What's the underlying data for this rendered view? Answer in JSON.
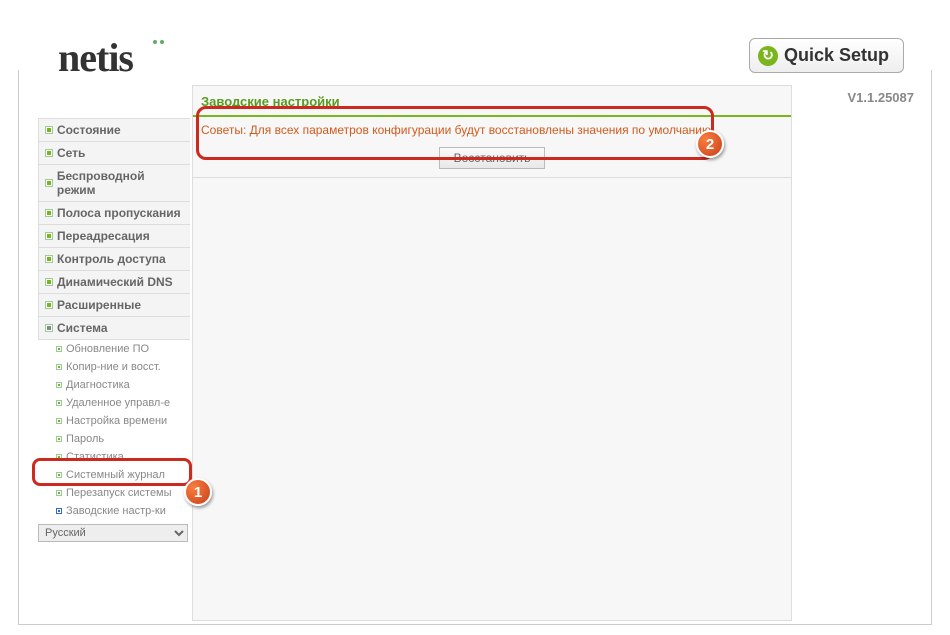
{
  "header": {
    "logo": "netis",
    "quick_setup": "Quick Setup",
    "version": "V1.1.25087"
  },
  "sidebar": {
    "items": [
      {
        "label": "Состояние"
      },
      {
        "label": "Сеть"
      },
      {
        "label": "Беспроводной режим"
      },
      {
        "label": "Полоса пропускания"
      },
      {
        "label": "Переадресация"
      },
      {
        "label": "Контроль доступа"
      },
      {
        "label": "Динамический DNS"
      },
      {
        "label": "Расширенные"
      },
      {
        "label": "Система"
      }
    ],
    "system_sub": [
      {
        "label": "Обновление ПО"
      },
      {
        "label": "Копир-ние и восст."
      },
      {
        "label": "Диагностика"
      },
      {
        "label": "Удаленное управл-е"
      },
      {
        "label": "Настройка времени"
      },
      {
        "label": "Пароль"
      },
      {
        "label": "Статистика"
      },
      {
        "label": "Системный журнал"
      },
      {
        "label": "Перезапуск системы"
      },
      {
        "label": "Заводские настр-ки"
      }
    ],
    "language": "Русский"
  },
  "main": {
    "title": "Заводские настройки",
    "advice": "Советы: Для всех параметров конфигурации будут восстановлены значения по умолчанию",
    "restore_label": "Восстановить"
  },
  "annotations": {
    "badge1": "1",
    "badge2": "2"
  }
}
